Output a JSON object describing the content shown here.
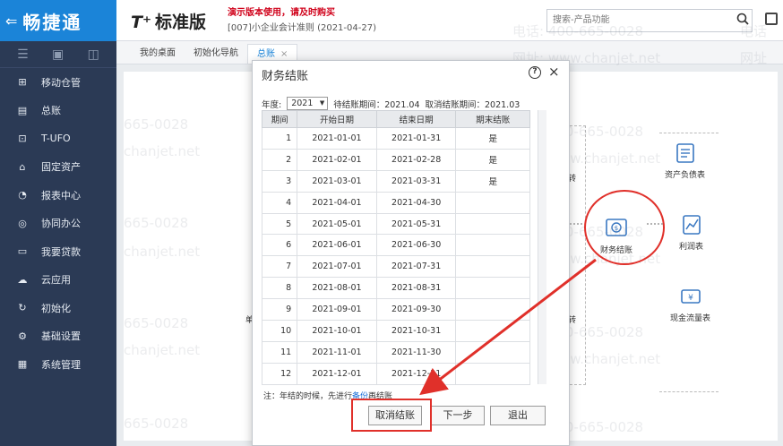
{
  "sidebar": {
    "brand": "畅捷通",
    "back_arrow": "⇐",
    "items": [
      {
        "label": "移动仓管",
        "icon": "warehouse-icon"
      },
      {
        "label": "总账",
        "icon": "ledger-icon"
      },
      {
        "label": "T-UFO",
        "icon": "ufo-report-icon"
      },
      {
        "label": "固定资产",
        "icon": "bank-icon"
      },
      {
        "label": "报表中心",
        "icon": "pie-chart-icon"
      },
      {
        "label": "协同办公",
        "icon": "collaboration-icon"
      },
      {
        "label": "我要贷款",
        "icon": "loan-icon"
      },
      {
        "label": "云应用",
        "icon": "cloud-icon"
      },
      {
        "label": "初始化",
        "icon": "refresh-icon"
      },
      {
        "label": "基础设置",
        "icon": "settings-icon"
      },
      {
        "label": "系统管理",
        "icon": "system-icon"
      }
    ]
  },
  "topbar": {
    "product_t": "T⁺",
    "product_name": "标准版",
    "demo_note": "演示版本使用，请及时购买",
    "account_info": "[007]小企业会计准则  (2021-04-27)",
    "search_placeholder": "搜索-产品功能"
  },
  "tabs": [
    {
      "label": "我的桌面",
      "active": false
    },
    {
      "label": "初始化导航",
      "active": false
    },
    {
      "label": "总账",
      "active": true,
      "close": "×"
    }
  ],
  "workspace": {
    "flow_nodes": [
      {
        "label": "财务结账",
        "icon": "close-books-icon"
      },
      {
        "label": "资产负债表",
        "icon": "balance-sheet-icon"
      },
      {
        "label": "利润表",
        "icon": "profit-statement-icon"
      },
      {
        "label": "现金流量表",
        "icon": "cash-flow-icon"
      }
    ],
    "side_char_1": "转",
    "side_char_2": "转",
    "left_char": "单"
  },
  "watermark": {
    "phone": "电话: 400-665-0028",
    "phone_partial": "665-0028",
    "site": "网址: www.chanjet.net",
    "site_partial": "chanjet.net",
    "phone_short": "电话",
    "site_short": "网址"
  },
  "modal": {
    "title": "财务结账",
    "help": "?",
    "close": "×",
    "year_label": "年度:",
    "year_value": "2021",
    "pending_period": "待结账期间：2021.04",
    "cancel_period": "取消结账期间：2021.03",
    "columns": [
      "期间",
      "开始日期",
      "结束日期",
      "期末结账"
    ],
    "rows": [
      [
        "1",
        "2021-01-01",
        "2021-01-31",
        "是"
      ],
      [
        "2",
        "2021-02-01",
        "2021-02-28",
        "是"
      ],
      [
        "3",
        "2021-03-01",
        "2021-03-31",
        "是"
      ],
      [
        "4",
        "2021-04-01",
        "2021-04-30",
        ""
      ],
      [
        "5",
        "2021-05-01",
        "2021-05-31",
        ""
      ],
      [
        "6",
        "2021-06-01",
        "2021-06-30",
        ""
      ],
      [
        "7",
        "2021-07-01",
        "2021-07-31",
        ""
      ],
      [
        "8",
        "2021-08-01",
        "2021-08-31",
        ""
      ],
      [
        "9",
        "2021-09-01",
        "2021-09-30",
        ""
      ],
      [
        "10",
        "2021-10-01",
        "2021-10-31",
        ""
      ],
      [
        "11",
        "2021-11-01",
        "2021-11-30",
        ""
      ],
      [
        "12",
        "2021-12-01",
        "2021-12-31",
        ""
      ]
    ],
    "note_prefix": "注：年结的时候，先进行",
    "note_link": "备份",
    "note_suffix": "再结账",
    "btn_cancel": "取消结账",
    "btn_next": "下一步",
    "btn_exit": "退出"
  },
  "colors": {
    "sidebar_bg": "#2b3a55",
    "brand_bg": "#1b84d8",
    "annotation_red": "#e0302a"
  }
}
